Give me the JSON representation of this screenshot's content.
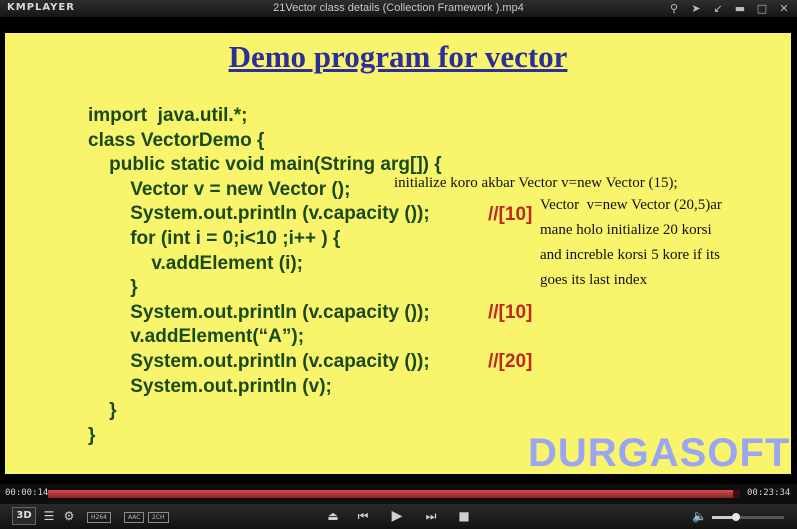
{
  "player": {
    "logo": "KMPLAYER",
    "title": "21Vector class details (Collection Framework ).mp4",
    "current_time": "00:00:14",
    "total_time": "00:23:34",
    "progress_fraction": 0.99,
    "volume_fraction": 0.3,
    "badges": [
      "H264",
      "AAC",
      "2CH"
    ],
    "logo_3d": "3D",
    "accent": "#c83c3c"
  },
  "slide": {
    "title": "Demo program for vector",
    "code": [
      "import  java.util.*;",
      "class VectorDemo {",
      "    public static void main(String arg[]) {",
      "        Vector v = new Vector ();",
      "        System.out.println (v.capacity ());",
      "        for (int i = 0;i<10 ;i++ ) {",
      "            v.addElement (i);",
      "        }",
      "        System.out.println (v.capacity ());",
      "        v.addElement(“A”);",
      "        System.out.println (v.capacity ());",
      "        System.out.println (v);",
      "    }",
      "}"
    ],
    "comments": [
      "//[10]",
      "//[10]",
      "//[20]"
    ],
    "notes": [
      "initialize koro akbar Vector v=new Vector (15);",
      "Vector  v=new Vector (20,5)ar",
      "mane holo initialize 20 korsi",
      "and increble korsi 5 kore if its",
      "goes its last index"
    ],
    "watermark": "DURGASOFT"
  }
}
